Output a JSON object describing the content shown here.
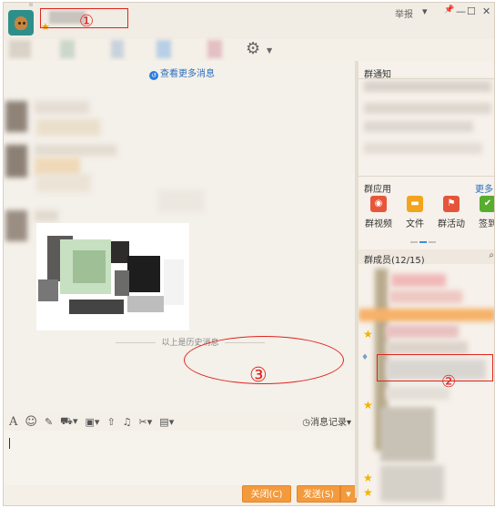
{
  "annotations": {
    "one": "①",
    "two": "②",
    "three": "③"
  },
  "window": {
    "report_label": "举报",
    "dropdown_glyph": "▾",
    "pin_glyph": "📌",
    "minimize_glyph": "—",
    "maximize_glyph": "☐",
    "close_glyph": "✕"
  },
  "chat": {
    "more_messages_link": "查看更多消息",
    "history_label": "以上是历史消息"
  },
  "input_toolbar": {
    "icons": [
      "font-icon",
      "emoji-icon",
      "magic-icon",
      "screenshot-icon",
      "image-icon",
      "upload-icon",
      "music-icon",
      "scissors-icon",
      "more-icon"
    ],
    "message_record_label": "消息记录"
  },
  "buttons": {
    "close_label": "关闭(C)",
    "send_label": "发送(S)",
    "send_dropdown_glyph": "▼"
  },
  "right_panel": {
    "notice_title": "群通知",
    "apps_title": "群应用",
    "apps_more": "更多",
    "apps": [
      {
        "label": "群视频",
        "color": "#e8563a"
      },
      {
        "label": "文件",
        "color": "#f3a41c"
      },
      {
        "label": "群活动",
        "color": "#e5553c"
      },
      {
        "label": "签到",
        "color": "#57ad2e"
      }
    ],
    "members_title": "群成员(12/15)"
  }
}
